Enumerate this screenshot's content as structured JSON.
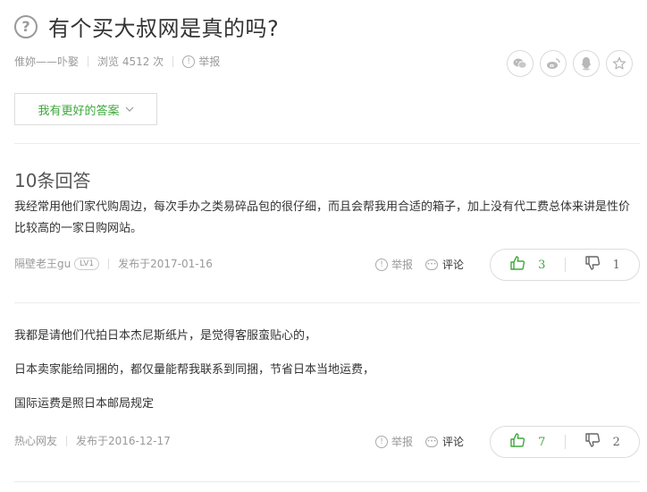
{
  "question": {
    "icon": "question-circle-icon",
    "title": "有个买大叔网是真的吗?"
  },
  "meta": {
    "author": "倠妳——卟娶",
    "views_label": "浏览 4512 次",
    "report_label": "举报"
  },
  "share": [
    {
      "name": "wechat-share-icon",
      "glyph": "💬"
    },
    {
      "name": "weibo-share-icon",
      "glyph": "◉"
    },
    {
      "name": "qq-share-icon",
      "glyph": "☺"
    },
    {
      "name": "favorite-star-icon",
      "glyph": "☆"
    }
  ],
  "better_answer_button": "我有更好的答案",
  "answer_count": "10条回答",
  "answers": [
    {
      "text": "我经常用他们家代购周边，每次手办之类易碎品包的很仔细，而且会帮我用合适的箱子，加上没有代工费总体来讲是性价比较高的一家日购网站。",
      "author": "隔壁老王gu",
      "level": "LV1",
      "date": "发布于2017-01-16",
      "report": "举报",
      "comment": "评论",
      "likes": "3",
      "dislikes": "1"
    },
    {
      "paragraphs": [
        "我都是请他们代拍日本杰尼斯纸片，是觉得客服蛮贴心的，",
        "日本卖家能给同捆的，都仅量能帮我联系到同捆，节省日本当地运费，",
        "国际运费是照日本邮局规定"
      ],
      "author": "热心网友",
      "date": "发布于2016-12-17",
      "report": "举报",
      "comment": "评论",
      "likes": "7",
      "dislikes": "2"
    }
  ],
  "colors": {
    "accent_green": "#3ea83c",
    "text": "#333333",
    "muted": "#999999",
    "border": "#dcdcdc"
  }
}
